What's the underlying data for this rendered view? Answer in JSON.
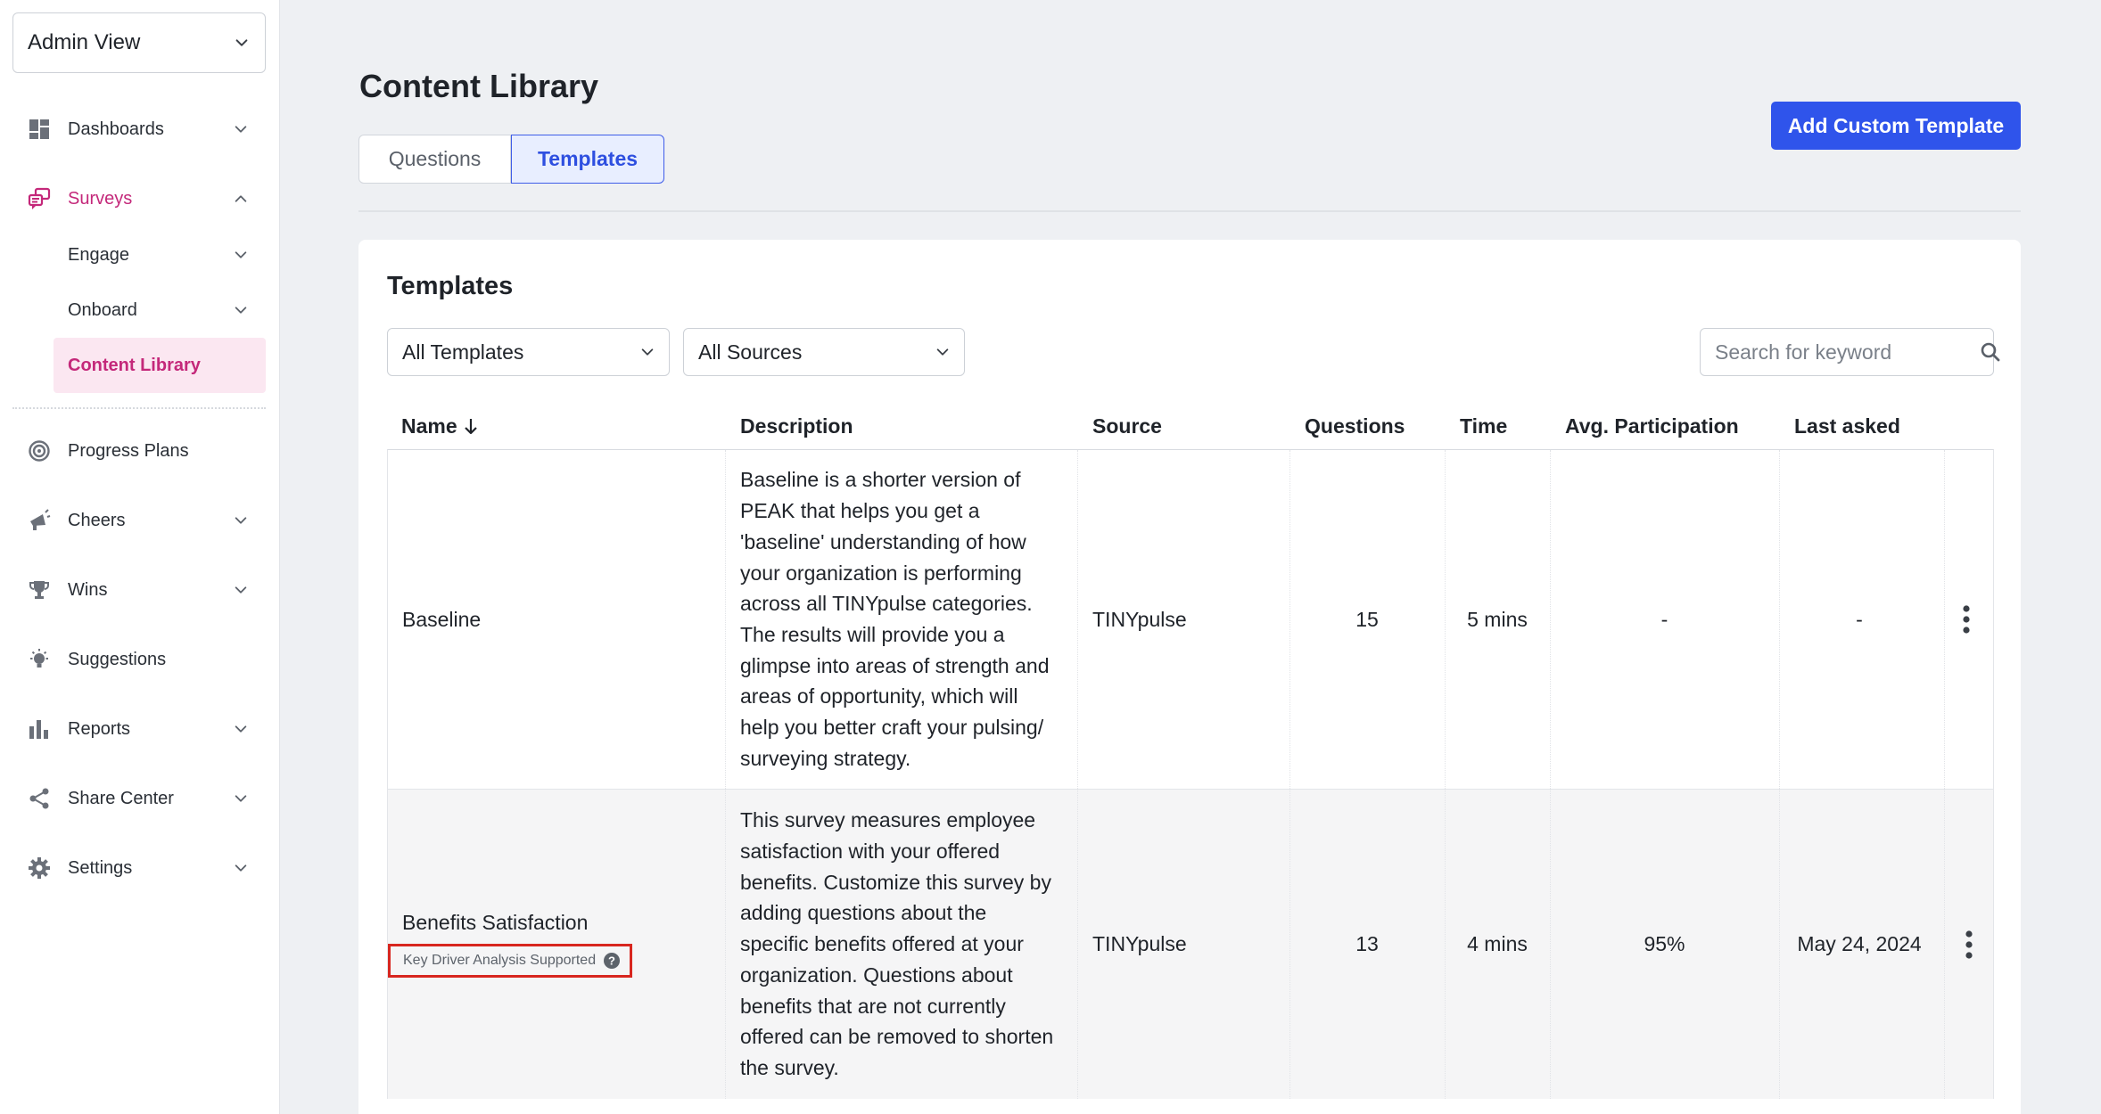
{
  "sidebar": {
    "view_select": "Admin View",
    "items": [
      {
        "label": "Dashboards"
      },
      {
        "label": "Surveys"
      },
      {
        "label": "Engage"
      },
      {
        "label": "Onboard"
      },
      {
        "label": "Content Library"
      },
      {
        "label": "Progress Plans"
      },
      {
        "label": "Cheers"
      },
      {
        "label": "Wins"
      },
      {
        "label": "Suggestions"
      },
      {
        "label": "Reports"
      },
      {
        "label": "Share Center"
      },
      {
        "label": "Settings"
      }
    ]
  },
  "header": {
    "title": "Content Library",
    "tabs": [
      "Questions",
      "Templates"
    ],
    "active_tab": "Templates",
    "add_button": "Add Custom Template"
  },
  "card": {
    "title": "Templates",
    "filters": {
      "templates": "All Templates",
      "sources": "All Sources"
    },
    "search": {
      "placeholder": "Search for keyword"
    }
  },
  "table": {
    "columns": [
      "Name",
      "Description",
      "Source",
      "Questions",
      "Time",
      "Avg. Participation",
      "Last asked"
    ],
    "rows": [
      {
        "name": "Baseline",
        "desc_lines": [
          "Baseline is a shorter version of",
          "PEAK that helps you get a",
          "'baseline' understanding of how",
          "your organization is performing",
          "across all TINYpulse categories.",
          "The results will provide you a",
          "glimpse into areas of strength and",
          "areas of opportunity, which will",
          "help you better craft your pulsing/",
          "surveying strategy."
        ],
        "source": "TINYpulse",
        "questions": "15",
        "time": "5 mins",
        "participation": "-",
        "last_asked": "-"
      },
      {
        "name": "Benefits Satisfaction",
        "badge": "Key Driver Analysis Supported",
        "desc_lines": [
          "This survey measures employee",
          "satisfaction with your offered",
          "benefits. Customize this survey by",
          "adding questions about the",
          "specific benefits offered at your",
          "organization. Questions about",
          "benefits that are not currently",
          "offered can be removed to shorten",
          "the survey."
        ],
        "source": "TINYpulse",
        "questions": "13",
        "time": "4 mins",
        "participation": "95%",
        "last_asked": "May 24, 2024"
      }
    ]
  },
  "colors": {
    "accent_blue": "#2f54eb",
    "brand_magenta": "#c4287a",
    "highlight_red": "#d8261f"
  }
}
